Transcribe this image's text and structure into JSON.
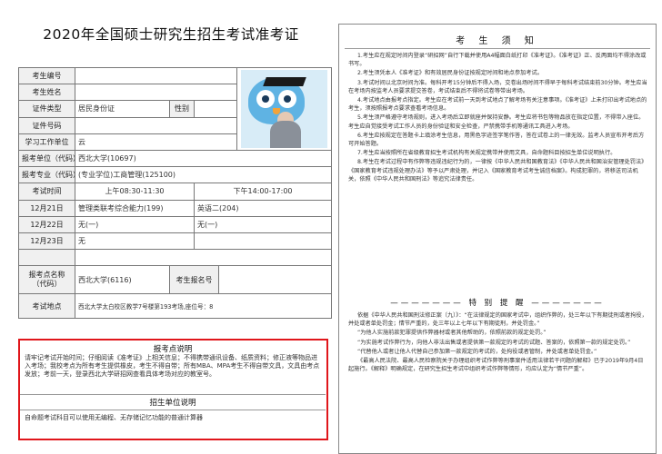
{
  "title": "2020年全国硕士研究生招生考试准考证",
  "ticket": {
    "labels": {
      "exam_no": "考生编号",
      "name": "考生姓名",
      "id_type": "证件类型",
      "gender": "性别",
      "id_no": "证件号码",
      "school": "学习工作单位",
      "apply_unit": "报考单位（代码）",
      "apply_major": "报考专业（代码）",
      "exam_time": "考试时间",
      "exam_site": "报考点名称（代码）",
      "room_no": "考生报名号",
      "location": "考试地点"
    },
    "values": {
      "id_type": "居民身份证",
      "school": "云",
      "apply_unit": "西北大学(10697)",
      "apply_major": "(专业学位)工商管理(125100)",
      "exam_site": "西北大学(6116)",
      "location": "西北大学太白校区教学7号楼第193考场,座位号：8"
    },
    "time_header": {
      "morning": "上午08:30-11:30",
      "afternoon": "下午14:00-17:00"
    },
    "schedule": [
      {
        "date": "12月21日",
        "morning": "管理类联考综合能力(199)",
        "afternoon": "英语二(204)"
      },
      {
        "date": "12月22日",
        "morning": "无(一)",
        "afternoon": "无(一)"
      },
      {
        "date": "12月23日",
        "morning": "无",
        "afternoon": ""
      }
    ]
  },
  "notice_exam_site": {
    "title": "报考点说明",
    "text": "请牢记考试开始时间；仔细阅读《准考证》上相关信息；不得携带通讯设备、纸质资料；修正液等物品进入考场；我校考点为所有考生提供橡皮，考生不得自带；所有MBA、MPA考生不得自带文具，文具由考点发放；考前一天，登录西北大学研招网查看具体考场对应的教室号。"
  },
  "notice_unit": {
    "title": "招生单位说明",
    "text": "自命题考试科目可以使用无编程、无存储记忆功能的普通计算器"
  },
  "rules": {
    "title": "考 生 须 知",
    "items": [
      "1.考生应在规定时间内登录“研招网”自行下载并使用A4幅面白纸打印《准考证》。《准考证》正、反两面均不得涂改或书写。",
      "2.考生须凭本人《准考证》和有效居民身份证按规定时间和地点参加考试。",
      "3.考试时间以北京时间为准。每科开考15分钟后不得入场，交卷出场时间不得早于每科考试结束前30分钟。考生应当在考场内按监考人员要求提交答卷，考试结束后不得将试卷等带出考场。",
      "4.考试地点由报考点指定。考生应在考试前一天到考试地点了解考场有关注意事项。《准考证》上未打印出考试地点的考生，须按照报考点要求查看考场信息。",
      "5.考生须严格遵守考场规则，进入考场后立即就座并保持安静。考生应将书包等物品放在指定位置，不得带入座位。考生应自觉接受考试工作人员的身份验证和安全检查，严禁携带手机等通讯工具进入考场。",
      "6.考生应按规定在答题卡上填涂考生信息，用黑色字迹签字笔作答，答在试卷上的一律无效。监考人员宣布开考后方可开始答题。",
      "7.考生应当按照所在省级教育招生考试机构有关规定携带并使用文具，自命题科目按招生单位说明执行。",
      "8.考生在考试过程中有作弊等违规违纪行为的，一律按《中华人民共和国教育法》《中华人民共和国治安管理处罚法》《国家教育考试违规处理办法》等予以严肃处理，并记入《国家教育考试考生诚信档案》。构成犯罪的，将移送司法机关，依照《中华人民共和国刑法》等追究法律责任。"
    ],
    "special_title": "特 别 提 醒",
    "special_items": [
      "依据《中华人民共和国刑法修正案（九）》：“在法律规定的国家考试中，组织作弊的，处三年以下有期徒刑或者拘役，并处或者单处罚金；情节严重的，处三年以上七年以下有期徒刑，并处罚金。”",
      "“为他人实施前款犯罪提供作弊器材或者其他帮助的，依照前款的规定处罚。”",
      "“为实施考试作弊行为，向他人非法出售或者提供第一款规定的考试的试题、答案的，依照第一款的规定处罚。”",
      "“代替他人或者让他人代替自己参加第一款规定的考试的，处拘役或者管制，并处或者单处罚金。”",
      "《最高人民法院、最高人民检察院关于办理组织考试作弊等刑事案件适用法律若干问题的解释》已于2019年9月4日起施行。《解释》明确规定，在研究生招生考试中组织考试作弊等情形，均应认定为“情节严重”。"
    ]
  }
}
